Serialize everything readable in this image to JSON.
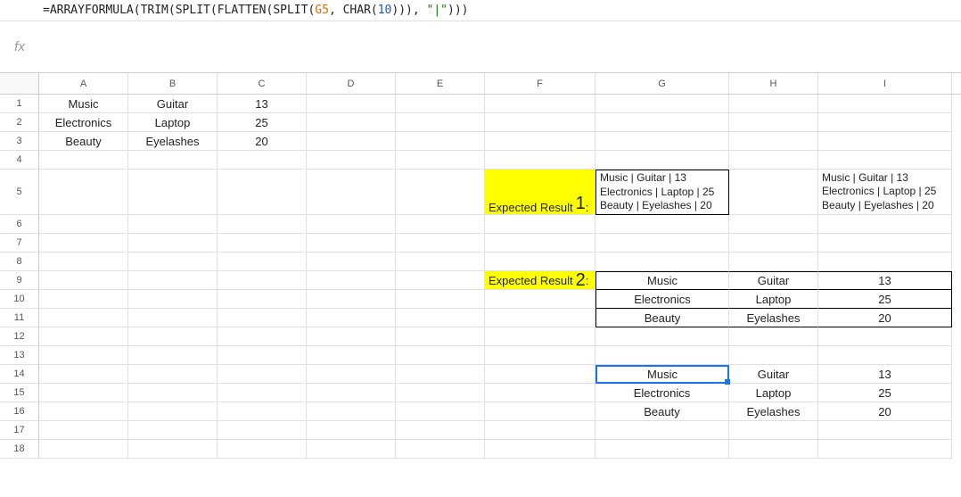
{
  "formula": {
    "prefix": "=",
    "fn1": "ARRAYFORMULA",
    "fn2": "TRIM",
    "fn3a": "SPLIT",
    "fn4": "FLATTEN",
    "fn3b": "SPLIT",
    "ref": "G5",
    "fn5": "CHAR",
    "num": "10",
    "str": "\"|\""
  },
  "fx": "fx",
  "cols": [
    "A",
    "B",
    "C",
    "D",
    "E",
    "F",
    "G",
    "H",
    "I"
  ],
  "rows": [
    "1",
    "2",
    "3",
    "4",
    "5",
    "6",
    "7",
    "8",
    "9",
    "10",
    "11",
    "12",
    "13",
    "14",
    "15",
    "16",
    "17",
    "18"
  ],
  "data": {
    "A1": "Music",
    "B1": "Guitar",
    "C1": "13",
    "A2": "Electronics",
    "B2": "Laptop",
    "C2": "25",
    "A3": "Beauty",
    "B3": "Eyelashes",
    "C3": "20",
    "F5a": "Expected Result ",
    "F5b": "1",
    "F5c": ":",
    "G5": "Music | Guitar | 13\nElectronics | Laptop | 25\nBeauty | Eyelashes | 20",
    "I5": "Music | Guitar | 13\nElectronics | Laptop | 25\nBeauty | Eyelashes | 20",
    "F9a": "Expected Result ",
    "F9b": "2",
    "F9c": ":",
    "G9": "Music",
    "H9": "Guitar",
    "I9": "13",
    "G10": "Electronics",
    "H10": "Laptop",
    "I10": "25",
    "G11": "Beauty",
    "H11": "Eyelashes",
    "I11": "20",
    "G14": "Music",
    "H14": "Guitar",
    "I14": "13",
    "G15": "Electronics",
    "H15": "Laptop",
    "I15": "25",
    "G16": "Beauty",
    "H16": "Eyelashes",
    "I16": "20"
  }
}
